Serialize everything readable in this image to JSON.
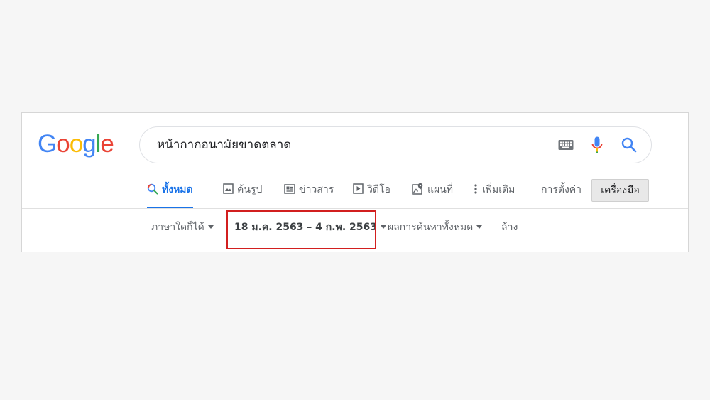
{
  "logo": {
    "letters": [
      "G",
      "o",
      "o",
      "g",
      "l",
      "e"
    ]
  },
  "colors": {
    "blue": "#4285f4",
    "red": "#ea4335",
    "yellow": "#fbbc05",
    "green": "#34a853",
    "active_tab": "#1a73e8",
    "highlight_border": "#d21f1f"
  },
  "search": {
    "query": "หน้ากากอนามัยขาดตลาด"
  },
  "tabs": [
    {
      "label": "ทั้งหมด",
      "icon": "search-icon",
      "active": true
    },
    {
      "label": "ค้นรูป",
      "icon": "image-icon"
    },
    {
      "label": "ข่าวสาร",
      "icon": "news-icon"
    },
    {
      "label": "วิดีโอ",
      "icon": "video-icon"
    },
    {
      "label": "แผนที่",
      "icon": "map-icon"
    },
    {
      "label": "เพิ่มเติม",
      "icon": "more-vert-icon"
    }
  ],
  "settings_label": "การตั้งค่า",
  "tools_label": "เครื่องมือ",
  "toolbar": {
    "language": "ภาษาใดก็ได้",
    "date_range": "18 ม.ค. 2563 – 4 ก.พ. 2563",
    "results": "ผลการค้นหาทั้งหมด",
    "clear": "ล้าง"
  }
}
